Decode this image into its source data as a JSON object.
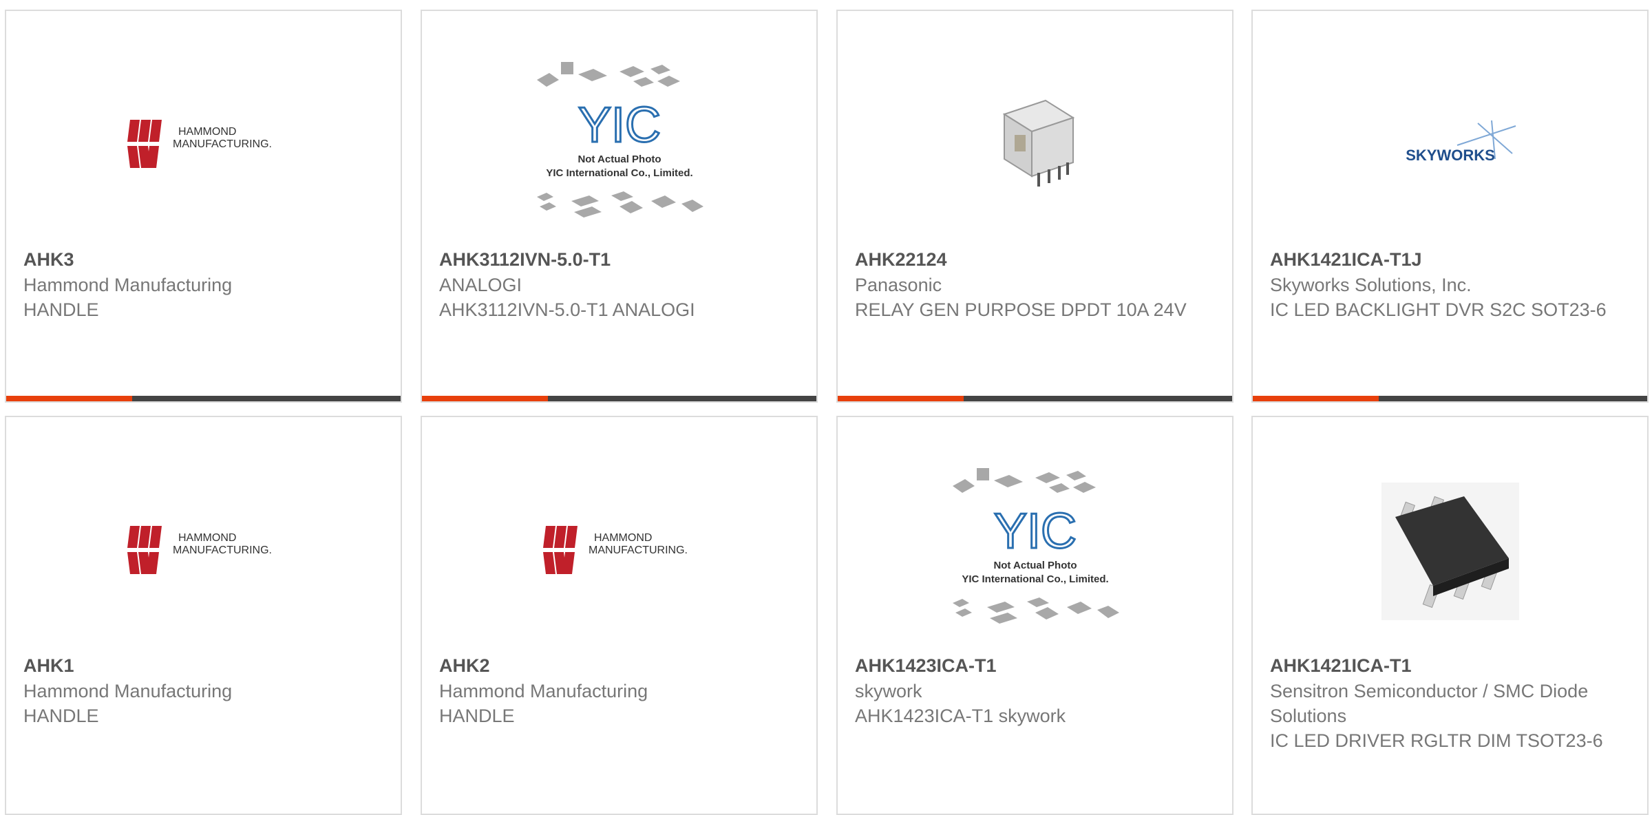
{
  "products": [
    {
      "part": "AHK3",
      "manufacturer": "Hammond Manufacturing",
      "description": "HANDLE",
      "image": "hammond-logo"
    },
    {
      "part": "AHK3112IVN-5.0-T1",
      "manufacturer": "ANALOGI",
      "description": "AHK3112IVN-5.0-T1 ANALOGI",
      "image": "yic-placeholder"
    },
    {
      "part": "AHK22124",
      "manufacturer": "Panasonic",
      "description": "RELAY GEN PURPOSE DPDT 10A 24V",
      "image": "relay-photo"
    },
    {
      "part": "AHK1421ICA-T1J",
      "manufacturer": "Skyworks Solutions, Inc.",
      "description": "IC LED BACKLIGHT DVR S2C SOT23-6",
      "image": "skyworks-logo"
    },
    {
      "part": "AHK1",
      "manufacturer": "Hammond Manufacturing",
      "description": "HANDLE",
      "image": "hammond-logo"
    },
    {
      "part": "AHK2",
      "manufacturer": "Hammond Manufacturing",
      "description": "HANDLE",
      "image": "hammond-logo"
    },
    {
      "part": "AHK1423ICA-T1",
      "manufacturer": "skywork",
      "description": "AHK1423ICA-T1 skywork",
      "image": "yic-placeholder"
    },
    {
      "part": "AHK1421ICA-T1",
      "manufacturer": "Sensitron Semiconductor / SMC Diode Solutions",
      "description": "IC LED DRIVER RGLTR DIM TSOT23-6",
      "image": "sot23-chip-photo"
    }
  ],
  "logos": {
    "hammond_line1": "HAMMOND",
    "hammond_line2": "MANUFACTURING.",
    "skyworks": "SKYWORKS",
    "yic_mark": "YIC",
    "yic_note1": "Not Actual Photo",
    "yic_note2": "YIC International Co., Limited."
  },
  "colors": {
    "accent": "#e8400c",
    "bar": "#444444",
    "hammond_red": "#c0202a",
    "skyworks_blue": "#1f4e8c",
    "yic_blue": "#2a6fb0"
  }
}
